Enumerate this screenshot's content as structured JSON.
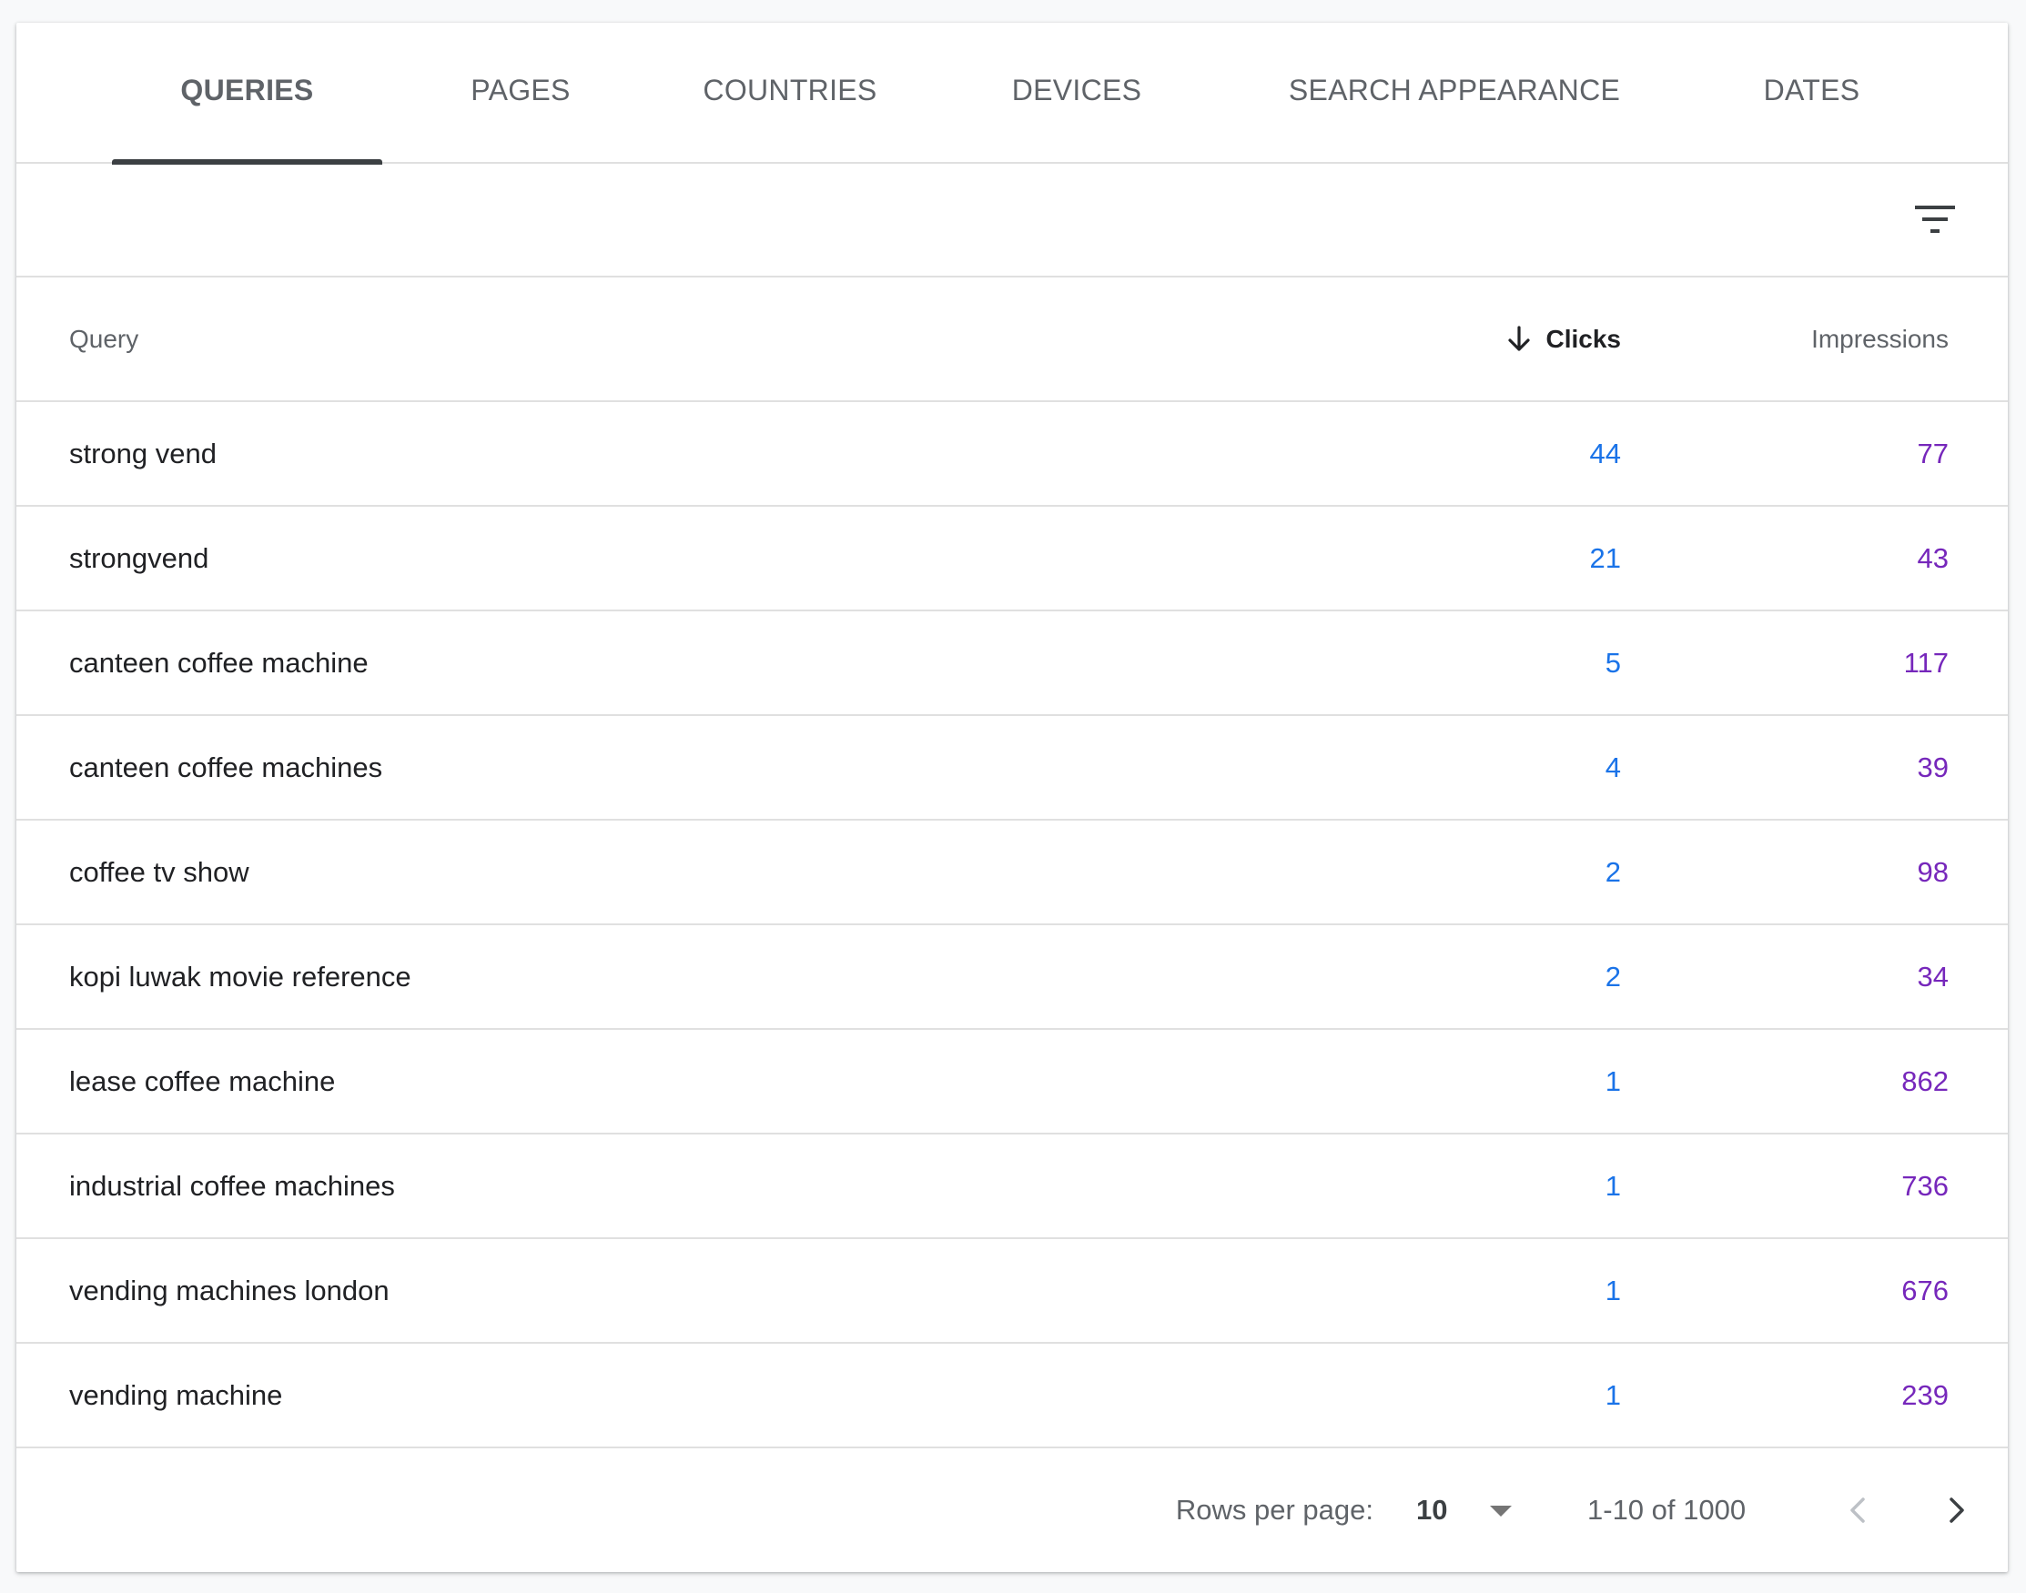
{
  "tabs": [
    {
      "label": "QUERIES",
      "active": true
    },
    {
      "label": "PAGES",
      "active": false
    },
    {
      "label": "COUNTRIES",
      "active": false
    },
    {
      "label": "DEVICES",
      "active": false
    },
    {
      "label": "SEARCH APPEARANCE",
      "active": false
    },
    {
      "label": "DATES",
      "active": false
    }
  ],
  "filter": {
    "icon": "filter-list-icon"
  },
  "table": {
    "columns": {
      "query": "Query",
      "clicks": "Clicks",
      "impressions": "Impressions"
    },
    "sort_icon": "arrow-down-icon",
    "rows": [
      {
        "query": "strong vend",
        "clicks": "44",
        "impressions": "77"
      },
      {
        "query": "strongvend",
        "clicks": "21",
        "impressions": "43"
      },
      {
        "query": "canteen coffee machine",
        "clicks": "5",
        "impressions": "117"
      },
      {
        "query": "canteen coffee machines",
        "clicks": "4",
        "impressions": "39"
      },
      {
        "query": "coffee tv show",
        "clicks": "2",
        "impressions": "98"
      },
      {
        "query": "kopi luwak movie reference",
        "clicks": "2",
        "impressions": "34"
      },
      {
        "query": "lease coffee machine",
        "clicks": "1",
        "impressions": "862"
      },
      {
        "query": "industrial coffee machines",
        "clicks": "1",
        "impressions": "736"
      },
      {
        "query": "vending machines london",
        "clicks": "1",
        "impressions": "676"
      },
      {
        "query": "vending machine",
        "clicks": "1",
        "impressions": "239"
      }
    ]
  },
  "pagination": {
    "rows_per_page_label": "Rows per page:",
    "rows_per_page_value": "10",
    "range": "1-10 of 1000",
    "prev_icon": "chevron-left-icon",
    "next_icon": "chevron-right-icon"
  },
  "colors": {
    "clicks": "#1a73e8",
    "impressions": "#7627bb",
    "tab_indicator": "#3c4043"
  }
}
